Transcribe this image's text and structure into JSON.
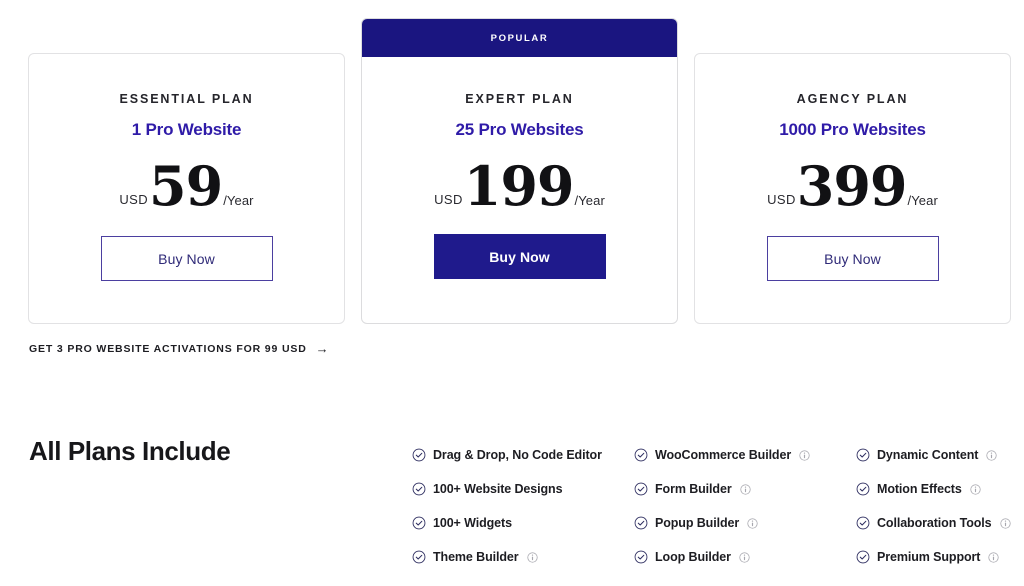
{
  "colors": {
    "brand_navy": "#1a1580",
    "brand_indigo": "#2f1ba8",
    "text_dark": "#1d1d22",
    "card_border": "#e2e2e4",
    "icon_gray": "#9a9aa2"
  },
  "plans": [
    {
      "badge": "",
      "name": "ESSENTIAL PLAN",
      "sites": "1 Pro Website",
      "currency": "USD",
      "amount": "59",
      "period": "/Year",
      "cta": "Buy Now",
      "cta_style": "outline",
      "featured": false
    },
    {
      "badge": "POPULAR",
      "name": "EXPERT PLAN",
      "sites": "25 Pro Websites",
      "currency": "USD",
      "amount": "199",
      "period": "/Year",
      "cta": "Buy Now",
      "cta_style": "filled",
      "featured": true
    },
    {
      "badge": "",
      "name": "AGENCY PLAN",
      "sites": "1000 Pro Websites",
      "currency": "USD",
      "amount": "399",
      "period": "/Year",
      "cta": "Buy Now",
      "cta_style": "outline",
      "featured": false
    }
  ],
  "promo": {
    "text": "GET 3 PRO WEBSITE ACTIVATIONS FOR 99  USD",
    "arrow": "→"
  },
  "includes": {
    "title": "All Plans Include",
    "columns": [
      {
        "items": [
          {
            "label": "Drag & Drop, No Code Editor",
            "info": false
          },
          {
            "label": "100+ Website Designs",
            "info": false
          },
          {
            "label": "100+ Widgets",
            "info": false
          },
          {
            "label": "Theme Builder",
            "info": true
          }
        ]
      },
      {
        "items": [
          {
            "label": "WooCommerce Builder",
            "info": true
          },
          {
            "label": "Form Builder",
            "info": true
          },
          {
            "label": "Popup Builder",
            "info": true
          },
          {
            "label": "Loop Builder",
            "info": true
          }
        ]
      },
      {
        "items": [
          {
            "label": "Dynamic Content",
            "info": true
          },
          {
            "label": "Motion Effects",
            "info": true
          },
          {
            "label": "Collaboration Tools",
            "info": true
          },
          {
            "label": "Premium Support",
            "info": true
          }
        ]
      }
    ]
  }
}
